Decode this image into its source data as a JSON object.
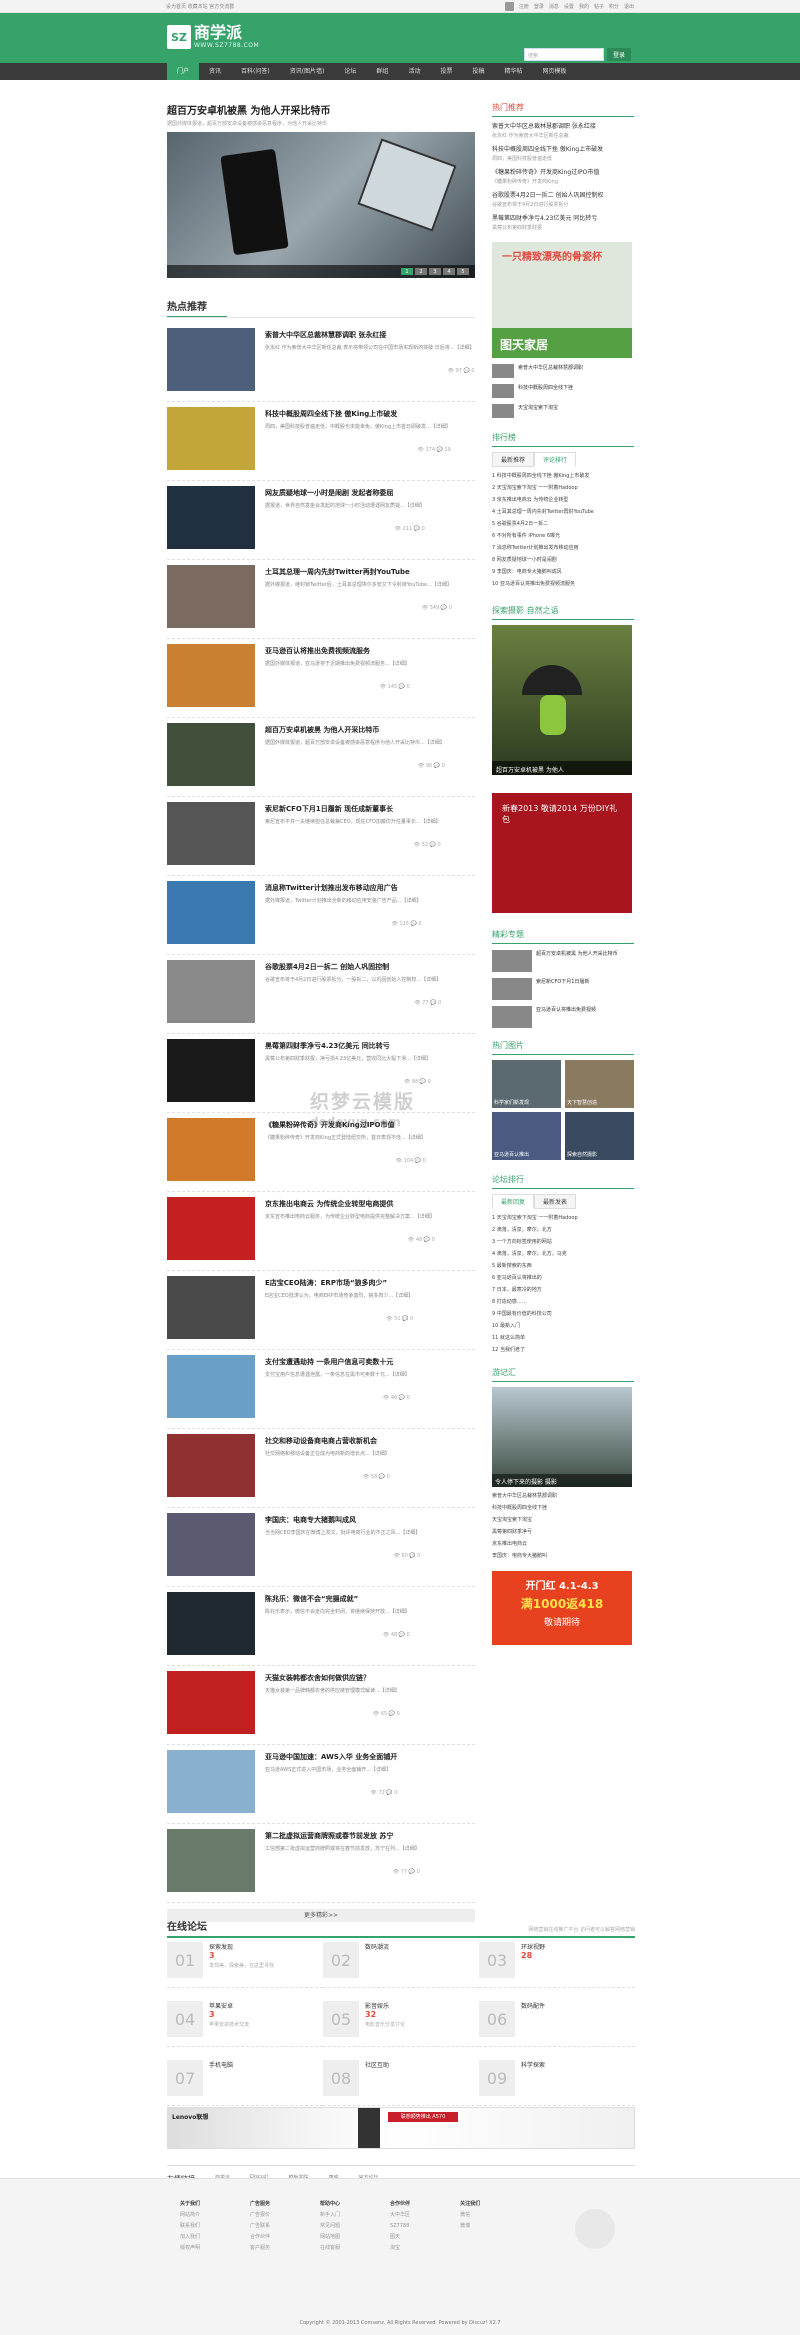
{
  "topbar": {
    "left": [
      "设为首页",
      "收藏本站",
      "官方交流群",
      "站长"
    ],
    "right": [
      "注册",
      "登录",
      "消息",
      "设置",
      "我的",
      "帖子",
      "积分",
      "退出"
    ]
  },
  "header": {
    "logo": "SZ",
    "name": "商学派",
    "url": "WWW.SZ7788.COM",
    "search_placeholder": "搜索",
    "login": "登录"
  },
  "nav": [
    "门户",
    "资讯",
    "百科(问答)",
    "资讯(图片墙)",
    "论坛",
    "群组",
    "活动",
    "投票",
    "投稿",
    "精华帖",
    "网页模板"
  ],
  "hero": {
    "title": "超百万安卓机被黑 为他人开采比特币",
    "sub": "据国外媒体报道，超百万部安卓设备被感染恶意程序，为他人开采比特币",
    "pager": [
      "1",
      "2",
      "3",
      "4",
      "5"
    ]
  },
  "hot_title": "热点推荐",
  "articles": [
    {
      "t": "索普大中华区总裁林慧郡调职 张永红接",
      "d": "张永红 作为索普大中华区新任总裁 表示将带领公司在中国市场实现新的突破 日后将...【详细】",
      "v": "97",
      "c": "0",
      "color": "#4d5f7a"
    },
    {
      "t": "科技中概股周四全线下挫 傲King上市破发",
      "d": "周四，美国科技股普遍走低，中概股也未能幸免，傲King上市首日即破发...【详细】",
      "v": "374",
      "c": "19",
      "color": "#c4a53a"
    },
    {
      "t": "网友质疑地球一小时是闹剧 发起者称委屈",
      "d": "据报道，世界自然基金会发起的地球一小时活动遭遇网友质疑...【详细】",
      "v": "211",
      "c": "0",
      "color": "#203040"
    },
    {
      "t": "土耳其总理一周内先封Twitter再封YouTube",
      "d": "据外媒报道，继封锁Twitter后，土耳其总理埃尔多安又下令封锁YouTube...【详细】",
      "v": "549",
      "c": "0",
      "color": "#7a6a60"
    },
    {
      "t": "亚马逊百认将推出免费视频流服务",
      "d": "据国外媒体报道，亚马逊将于近期推出免费视频流服务...【详细】",
      "v": "145",
      "c": "0",
      "color": "#c98030"
    },
    {
      "t": "超百万安卓机被黑 为他人开采比特币",
      "d": "据国外媒体报道，超百万部安卓设备被感染恶意程序为他人开采比特币...【详细】",
      "v": "90",
      "c": "0",
      "color": "#40503a"
    },
    {
      "t": "索尼新CFO下月1日履新 现任成新董事长",
      "d": "索尼宣布平井一夫继续担任总裁兼CEO，现任CFO加藤优升任董事长...【详细】",
      "v": "52",
      "c": "0",
      "color": "#555555"
    },
    {
      "t": "消息称Twitter计划推出发布移动应用广告",
      "d": "据外媒报道，Twitter计划推出全新的移动应用安装广告产品...【详细】",
      "v": "115",
      "c": "0",
      "color": "#3a7ab0"
    },
    {
      "t": "谷歌股票4月2日一拆二 创始人巩固控制",
      "d": "谷歌宣布将于4月2日进行股票拆分，一股拆二，以巩固创始人控制权...【详细】",
      "v": "77",
      "c": "0",
      "color": "#8a8a8a"
    },
    {
      "t": "黑莓第四财季净亏4.23亿美元 同比转亏",
      "d": "黑莓公布第四财季财报，净亏损4.23亿美元，营收同比大幅下滑...【详细】",
      "v": "88",
      "c": "0",
      "color": "#1a1a1a"
    },
    {
      "t": "《糖果粉碎传奇》开发商King过IPO市值",
      "d": "《糖果粉碎传奇》开发商King正式登陆纽交所，首日表现不佳...【详细】",
      "v": "104",
      "c": "0",
      "color": "#d07a2a"
    },
    {
      "t": "京东推出电商云 为传统企业转型电商提供",
      "d": "京东宣布推出电商云服务，为传统企业转型电商提供完整解决方案...【详细】",
      "v": "48",
      "c": "0",
      "color": "#c42020"
    },
    {
      "t": "E店宝CEO陆涛：ERP市场“狼多肉少”",
      "d": "E店宝CEO陆涛认为，电商ERP市场竞争激烈，狼多肉少...【详细】",
      "v": "51",
      "c": "0",
      "color": "#4a4a4a"
    },
    {
      "t": "支付宝遭遇劫持 一条用户信息可卖数十元",
      "d": "支付宝用户信息遭遇泄露，一条信息在黑市可卖数十元...【详细】",
      "v": "46",
      "c": "0",
      "color": "#6aa0c8"
    },
    {
      "t": "社交和移动设备商电商占营收新机会",
      "d": "社交网络和移动设备正在成为电商新的增长点...【详细】",
      "v": "58",
      "c": "0",
      "color": "#903030"
    },
    {
      "t": "李国庆：电商专大猪鹅叫成风",
      "d": "当当网CEO李国庆在微博上发文，批评电商行业的不正之风...【详细】",
      "v": "60",
      "c": "0",
      "color": "#5a5a70"
    },
    {
      "t": "陈兆乐：微信不会“完摄成就”",
      "d": "陈兆乐表示，微信不会走向完全封闭，将继续保持开放...【详细】",
      "v": "48",
      "c": "0",
      "color": "#202830"
    },
    {
      "t": "天猫女装韩都衣舍如何做供应链？",
      "d": "天猫女装第一品牌韩都衣舍的供应链管理模式解读...【详细】",
      "v": "65",
      "c": "0",
      "color": "#c02020"
    },
    {
      "t": "亚马逊中国加速：AWS入华 业务全面铺开",
      "d": "亚马逊AWS正式进入中国市场，业务全面铺开...【详细】",
      "v": "72",
      "c": "0",
      "color": "#8ab0d0"
    },
    {
      "t": "第二批虚拟运营商牌照或春节前发放 苏宁",
      "d": "工信部第二批虚拟运营商牌照或将在春节前发放，苏宁在列...【详细】",
      "v": "77",
      "c": "0",
      "color": "#6a7a6a"
    }
  ],
  "more": "更多精彩>>",
  "side": {
    "hot_title": "热门推荐",
    "hot": [
      {
        "t": "索普大中华区总裁林慧郡调职 张永红接",
        "d": "张永红 作为索普大中华区新任总裁"
      },
      {
        "t": "科技中概股周四全线下挫 傲King上市破发",
        "d": "周四，美国科技股普遍走低"
      },
      {
        "t": "《糖果粉碎传奇》开发商King过IPO市值",
        "d": "《糖果粉碎传奇》开发商King"
      },
      {
        "t": "谷歌股票4月2日一拆二 创始人巩固控制权",
        "d": "谷歌宣布将于4月2日进行股票拆分"
      },
      {
        "t": "黑莓第四财季净亏4.23亿美元 同比转亏",
        "d": "黑莓公布第四财季财报"
      }
    ],
    "ad1": {
      "t": "一只精致漂亮的骨瓷杯",
      "g": "图天家居"
    },
    "small": [
      {
        "t": "索普大中华区总裁林慧郡调职"
      },
      {
        "t": "科技中概股周四全线下挫"
      },
      {
        "t": "天宝淘宝索下淘宝"
      }
    ],
    "rank_title": "排行榜",
    "rank_tabs": [
      "最新推荐",
      "评论排行"
    ],
    "rank": [
      "1 科技中概股周四全线下挫 傲King上市破发",
      "2 天宝淘宝索下淘宝 一一附着Hadoop",
      "3 京东推出电商云 为传统企业转型",
      "4 土耳其总理一周内先封Twitter再封YouTube",
      "5 谷歌股票4月2日一拆二",
      "6 不对所有事件 iPhone 6曝光",
      "7 消息称Twitter计划推出发布移动应用",
      "8 网友质疑地球一小时是闹剧",
      "9 李国庆：电商专大猪鹅叫成风",
      "10 亚马逊百认将推出免费视频流服务"
    ],
    "album_title": "探索摄影 自然之语",
    "album_cap": "超百万安卓机被黑 为他人",
    "ad2": "新春2013 敬请2014 万份DIY礼包",
    "pic_title": "精彩专题",
    "pics": [
      {
        "t": "超百万安卓机被黑 为他人开采比特币"
      },
      {
        "t": "索尼新CFO下月1日履新"
      },
      {
        "t": "亚马逊百认将推出免费视频"
      }
    ],
    "wall_title": "热门图片",
    "wall": [
      "科学家们新发现",
      "天下智慧创造",
      "亚马逊百认推出",
      "探索自然摄影"
    ],
    "forum_title": "论坛排行",
    "forum_tabs": [
      "最新回复",
      "最新发表"
    ],
    "forum": [
      "1 天宝淘宝索下淘宝 一一附着Hadoop",
      "2 滴落，清泉，摩尔，北方",
      "3 一个方向标签使用的网站",
      "4 滴落，清泉，摩尔，北方，马克",
      "5 最新搜索的东西",
      "6 亚马逊百认将推出的",
      "7 日本，最寒冷的地方",
      "8 打造动感……",
      "9 中国最有价值的科技公司",
      "10 最新入门",
      "11 就这么简单",
      "12 当我们老了"
    ],
    "travel_title": "游记汇",
    "travel_cap": "令人停下来的摄影 摄影",
    "travel_list": [
      "索普大中华区总裁林慧郡调职",
      "科技中概股周四全线下挫",
      "天宝淘宝索下淘宝",
      "黑莓第四财季净亏",
      "京东推出电商云",
      "李国庆：电商专大猪鹅叫"
    ],
    "ad3": {
      "a": "开门红 4.1-4.3",
      "b": "满1000返418",
      "c": "敬请期待"
    }
  },
  "forum_title": "在线论坛",
  "forum_sub": "网络营销在线推广平台 访问者可以解答网络营销",
  "forums": [
    {
      "n": "01",
      "name": "探索发现",
      "cnt": "3",
      "desc": "发现美，探索美，在这里寻找"
    },
    {
      "n": "02",
      "name": "数码潮流",
      "cnt": "",
      "desc": ""
    },
    {
      "n": "03",
      "name": "环球视野",
      "cnt": "28",
      "desc": ""
    },
    {
      "n": "04",
      "name": "苹果安卓",
      "cnt": "3",
      "desc": "苹果安卓技术交流"
    },
    {
      "n": "05",
      "name": "影音娱乐",
      "cnt": "32",
      "desc": "电影音乐分享讨论"
    },
    {
      "n": "06",
      "name": "数码配件",
      "cnt": "",
      "desc": ""
    },
    {
      "n": "07",
      "name": "手机电脑",
      "cnt": "",
      "desc": ""
    },
    {
      "n": "08",
      "name": "社区互助",
      "cnt": "",
      "desc": ""
    },
    {
      "n": "09",
      "name": "科学探索",
      "cnt": "",
      "desc": ""
    }
  ],
  "banner": {
    "left": "Lenovo联想",
    "right": "联想顺势推出 A570"
  },
  "links": {
    "title": "友情链接",
    "items": [
      "商学派",
      "Discuz!",
      "模板学院",
      "康盛",
      "官方论坛"
    ]
  },
  "footer": {
    "cols": [
      {
        "h": "关于我们",
        "items": [
          "网站简介",
          "联系我们",
          "加入我们",
          "版权声明"
        ]
      },
      {
        "h": "广告服务",
        "items": [
          "广告报价",
          "广告联系",
          "合作伙伴",
          "客户服务"
        ]
      },
      {
        "h": "帮助中心",
        "items": [
          "新手入门",
          "常见问题",
          "网站地图",
          "在线客服"
        ]
      },
      {
        "h": "合作伙伴",
        "items": [
          "大中华区",
          "SZ7788",
          "图天",
          "淘宝"
        ]
      },
      {
        "h": "关注我们",
        "items": [
          "微信",
          "微博"
        ]
      }
    ],
    "copy": "Copyright © 2001-2013 Comsenz. All Rights Reserved. Powered by Discuz! X2.7"
  },
  "watermark": "织梦云模版",
  "watermark2": "dedeyun.com"
}
